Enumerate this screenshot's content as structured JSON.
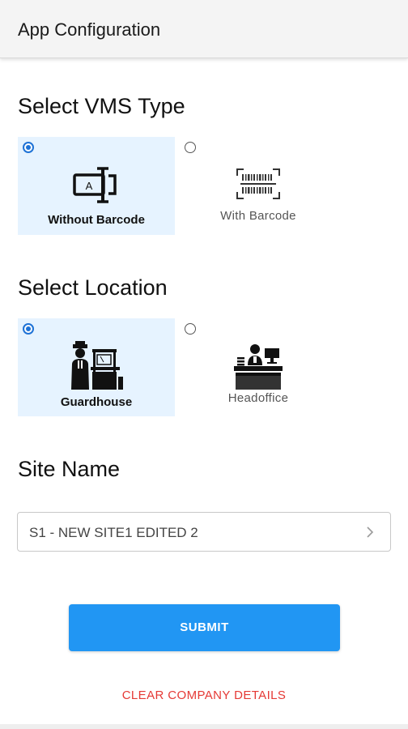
{
  "header": {
    "title": "App Configuration"
  },
  "vms_section": {
    "title": "Select VMS Type",
    "options": [
      {
        "label": "Without Barcode",
        "icon": "id-card-icon",
        "selected": true
      },
      {
        "label": "With Barcode",
        "icon": "barcode-scan-icon",
        "selected": false
      }
    ]
  },
  "location_section": {
    "title": "Select Location",
    "options": [
      {
        "label": "Guardhouse",
        "icon": "guard-icon",
        "selected": true
      },
      {
        "label": "Headoffice",
        "icon": "reception-desk-icon",
        "selected": false
      }
    ]
  },
  "site_section": {
    "title": "Site Name",
    "selected_value": "S1 - NEW SITE1 EDITED 2"
  },
  "actions": {
    "submit_label": "SUBMIT",
    "clear_label": "CLEAR COMPANY DETAILS"
  },
  "colors": {
    "accent": "#2196f3",
    "radio": "#1e72d6",
    "selected_bg": "#e6f3ff",
    "danger": "#e53935"
  }
}
